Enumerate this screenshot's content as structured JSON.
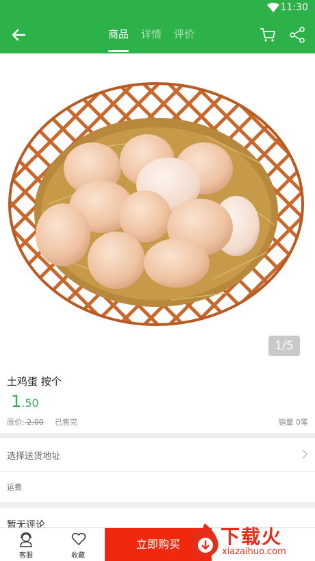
{
  "status_bar": {
    "time": "11:30"
  },
  "header": {
    "tabs": [
      {
        "label": "商品",
        "active": true
      },
      {
        "label": "详情",
        "active": false
      },
      {
        "label": "评价",
        "active": false
      }
    ],
    "accent_color": "#2db24a"
  },
  "gallery": {
    "indicator": "1/5",
    "image": "eggs-in-basket"
  },
  "product": {
    "title": "土鸡蛋  按个",
    "price_int": "1",
    "price_dec": ".50",
    "original_label": "原价:",
    "original_price": " 2.00",
    "sold_out": "已售完",
    "sales": "销量 0笔"
  },
  "delivery": {
    "address_label": "选择送货地址",
    "fee_label": "运费"
  },
  "reviews": {
    "label": "暂无评论"
  },
  "bottom_bar": {
    "service_label": "客服",
    "favorite_label": "收藏",
    "buy_label": "立即购买",
    "buy_color": "#f0290e"
  },
  "watermark": {
    "text": "下载火",
    "url": "xiazaihuo.com"
  }
}
